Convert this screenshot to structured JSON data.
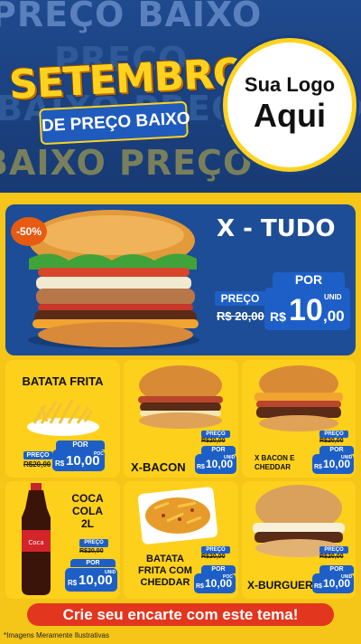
{
  "header": {
    "bg_words": [
      "PREÇO BAIXO",
      "PREÇO",
      "BAIXO PREÇO BAIXO",
      "BAIXO PREÇO"
    ],
    "title_line1": "SETEMBRO",
    "title_line2": "DE PREÇO BAIXO",
    "logo_line1": "Sua Logo",
    "logo_line2": "Aqui"
  },
  "featured": {
    "name": "X - TUDO",
    "discount": "-50%",
    "old_label": "PREÇO",
    "old_price": "R$ 20,00",
    "por": "POR",
    "currency": "R$",
    "price_int": "10",
    "price_dec": ",00",
    "unit": "UNID"
  },
  "products": [
    {
      "name": "BATATA FRITA",
      "old_label": "PREÇO",
      "old_price": "R$20,00",
      "por": "POR",
      "currency": "R$",
      "price": "10,00",
      "unit": "POC"
    },
    {
      "name": "X-BACON",
      "old_label": "PREÇO",
      "old_price": "R$20,00",
      "por": "POR",
      "currency": "R$",
      "price": "10,00",
      "unit": "UNID"
    },
    {
      "name": "X BACON E CHEDDAR",
      "old_label": "PREÇO",
      "old_price": "R$20,00",
      "por": "POR",
      "currency": "R$",
      "price": "10,00",
      "unit": "UNID"
    },
    {
      "name": "COCA COLA 2L",
      "old_label": "PREÇO",
      "old_price": "R$20,00",
      "por": "POR",
      "currency": "R$",
      "price": "10,00",
      "unit": "UNID"
    },
    {
      "name": "BATATA FRITA COM CHEDDAR",
      "old_label": "PREÇO",
      "old_price": "R$20,00",
      "por": "POR",
      "currency": "R$",
      "price": "10,00",
      "unit": "POC"
    },
    {
      "name": "X-BURGUER",
      "old_label": "PREÇO",
      "old_price": "R$20,00",
      "por": "POR",
      "currency": "R$",
      "price": "10,00",
      "unit": "UNID"
    }
  ],
  "footer": {
    "cta": "Crie seu encarte com este tema!",
    "disclaimer": "*Imagens Meramente Ilustrativas"
  },
  "colors": {
    "brand_yellow": "#f5c518",
    "brand_blue": "#1d4d96",
    "cta_red": "#e2361f"
  }
}
